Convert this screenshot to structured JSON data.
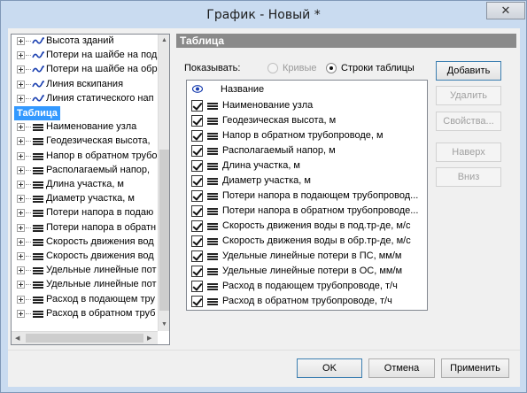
{
  "window": {
    "title": "График - Новый *",
    "close_label": "✕"
  },
  "tree": {
    "curve_items": [
      "Высота зданий",
      "Потери на шайбе на под",
      "Потери на шайбе на обр",
      "Линия вскипания",
      "Линия статического нап"
    ],
    "root_label": "Таблица",
    "table_items": [
      "Наименование узла",
      "Геодезическая высота,",
      "Напор в обратном трубо",
      "Располагаемый напор,",
      "Длина участка, м",
      "Диаметр участка, м",
      "Потери напора в подаю",
      "Потери напора в обратн",
      "Скорость движения вод",
      "Скорость движения вод",
      "Удельные линейные пот",
      "Удельные линейные пот",
      "Расход в подающем тру",
      "Расход в обратном труб"
    ]
  },
  "panel": {
    "header": "Таблица",
    "show_label": "Показывать:",
    "radio_curves": "Кривые",
    "radio_rows": "Строки таблицы",
    "column_name": "Название",
    "rows": [
      "Наименование узла",
      "Геодезическая высота, м",
      "Напор в обратном трубопроводе, м",
      "Располагаемый напор, м",
      "Длина участка, м",
      "Диаметр участка, м",
      "Потери напора в подающем трубопровод...",
      "Потери напора в обратном трубопроводе...",
      "Скорость движения воды в под.тр-де, м/с",
      "Скорость движения воды в обр.тр-де, м/с",
      "Удельные линейные потери в ПС, мм/м",
      "Удельные линейные потери в ОС, мм/м",
      "Расход в подающем трубопроводе, т/ч",
      "Расход в обратном трубопроводе, т/ч"
    ]
  },
  "side_buttons": {
    "add": "Добавить",
    "delete": "Удалить",
    "properties": "Свойства...",
    "up": "Наверх",
    "down": "Вниз"
  },
  "footer": {
    "ok": "OK",
    "cancel": "Отмена",
    "apply": "Применить"
  },
  "colors": {
    "selection": "#3399ff",
    "header_bg": "#8a8a8a",
    "wave_icon": "#1a3fb0"
  }
}
